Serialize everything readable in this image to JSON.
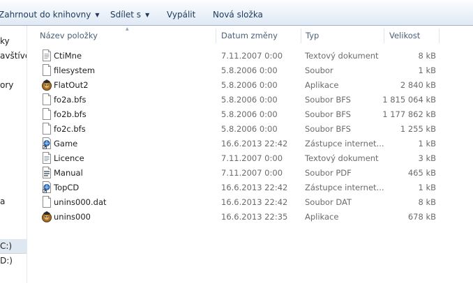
{
  "toolbar": {
    "include_label": "Zahrnout do knihovny",
    "share_label": "Sdílet s",
    "burn_label": "Vypálit",
    "new_folder_label": "Nová složka"
  },
  "nav": {
    "items": [
      {
        "label": "ky"
      },
      {
        "label": "avštíver"
      },
      {
        "label": "ory"
      },
      {
        "label": "a"
      },
      {
        "label": "C:)"
      },
      {
        "label": "D:)"
      }
    ]
  },
  "columns": {
    "name": "Název položky",
    "date": "Datum změny",
    "type": "Typ",
    "size": "Velikost"
  },
  "files": [
    {
      "name": "CtiMne",
      "date": "7.11.2007 0:00",
      "type": "Textový dokument",
      "size": "8 kB",
      "icon": "text-document-icon"
    },
    {
      "name": "filesystem",
      "date": "5.8.2006 0:00",
      "type": "Soubor",
      "size": "1 kB",
      "icon": "file-icon"
    },
    {
      "name": "FlatOut2",
      "date": "5.8.2006 0:00",
      "type": "Aplikace",
      "size": "2 840 kB",
      "icon": "application-icon"
    },
    {
      "name": "fo2a.bfs",
      "date": "5.8.2006 0:00",
      "type": "Soubor BFS",
      "size": "1 815 064 kB",
      "icon": "file-icon"
    },
    {
      "name": "fo2b.bfs",
      "date": "5.8.2006 0:00",
      "type": "Soubor BFS",
      "size": "1 177 862 kB",
      "icon": "file-icon"
    },
    {
      "name": "fo2c.bfs",
      "date": "5.8.2006 0:00",
      "type": "Soubor BFS",
      "size": "1 255 kB",
      "icon": "file-icon"
    },
    {
      "name": "Game",
      "date": "16.6.2013 22:42",
      "type": "Zástupce internet...",
      "size": "1 kB",
      "icon": "internet-shortcut-icon"
    },
    {
      "name": "Licence",
      "date": "7.11.2007 0:00",
      "type": "Textový dokument",
      "size": "3 kB",
      "icon": "text-document-icon"
    },
    {
      "name": "Manual",
      "date": "7.11.2007 0:00",
      "type": "Soubor PDF",
      "size": "465 kB",
      "icon": "pdf-document-icon"
    },
    {
      "name": "TopCD",
      "date": "16.6.2013 22:42",
      "type": "Zástupce internet...",
      "size": "1 kB",
      "icon": "internet-shortcut-icon"
    },
    {
      "name": "unins000.dat",
      "date": "16.6.2013 22:42",
      "type": "Soubor DAT",
      "size": "8 kB",
      "icon": "file-icon"
    },
    {
      "name": "unins000",
      "date": "16.6.2013 22:35",
      "type": "Aplikace",
      "size": "678 kB",
      "icon": "application-icon"
    }
  ]
}
